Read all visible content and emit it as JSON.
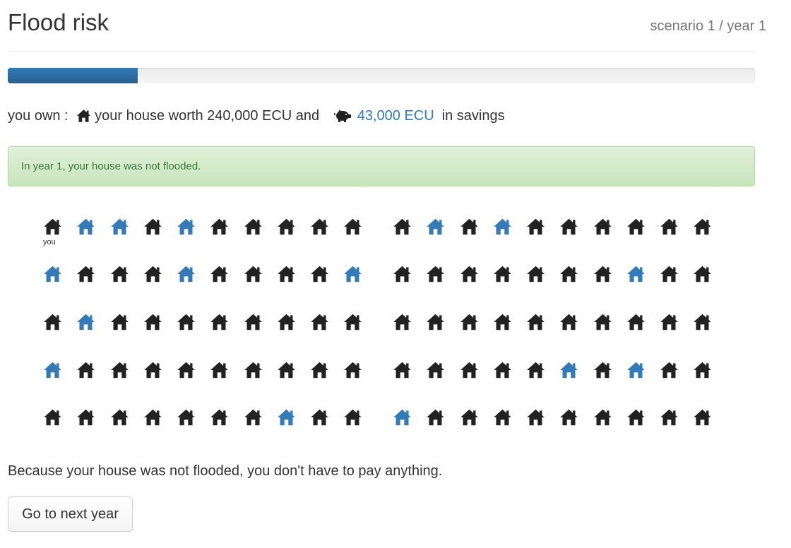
{
  "header": {
    "title": "Flood risk",
    "subtitle": "scenario 1 / year 1"
  },
  "progress": {
    "fraction": 0.174
  },
  "ownership": {
    "prefix": "you own : ",
    "house_icon": "house-icon",
    "house_text": "your house worth 240,000 ECU and ",
    "savings_icon": "piggy-bank-icon",
    "savings_amount": "43,000 ECU",
    "savings_suffix": "in savings"
  },
  "alert": {
    "text": "In year 1, your house was not flooded."
  },
  "grid": {
    "you_label": "you",
    "rows": [
      "0110100000 0101000000",
      "1000100001 0000000100",
      "0100000000 0000000000",
      "1000000000 0000010100",
      "0000000100 1000000000"
    ],
    "flooded_color": "#337ab7",
    "normal_color": "#222222"
  },
  "message": "Because your house was not flooded, you don't have to pay anything.",
  "next_button": {
    "label": "Go to next year"
  },
  "colors": {
    "link": "#337ab7",
    "alert_text": "#3c763d",
    "progress": "#337ab7"
  }
}
